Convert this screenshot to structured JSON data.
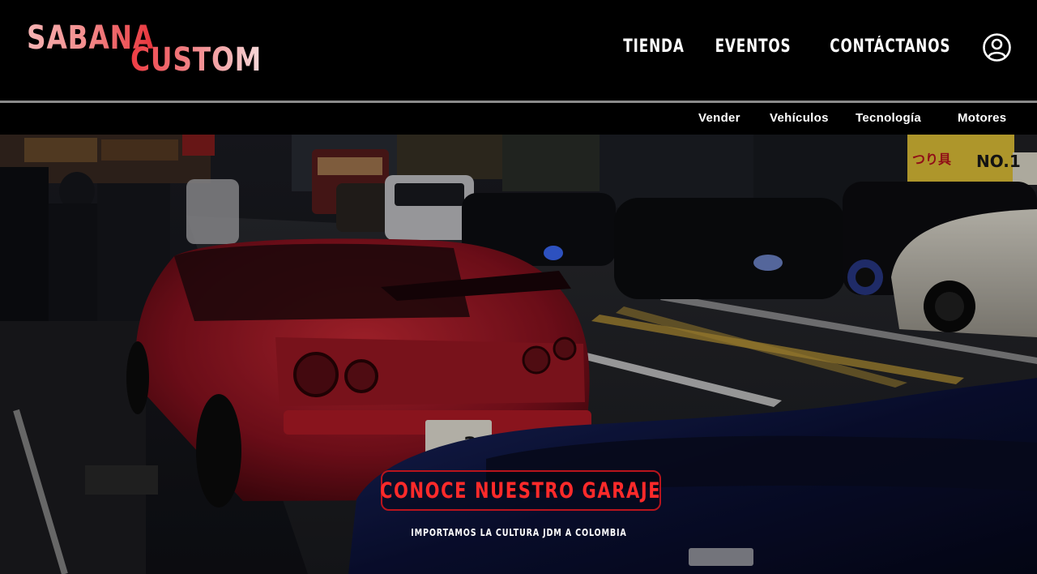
{
  "brand": {
    "line1": "SABANA",
    "line2": "CUSTOM"
  },
  "main_nav": [
    {
      "label": "TIENDA"
    },
    {
      "label": "EVENTOS"
    },
    {
      "label": "CONTÁCTANOS"
    }
  ],
  "icons": {
    "account": "user-circle-icon"
  },
  "sub_nav": [
    {
      "label": "Vender"
    },
    {
      "label": "Vehículos"
    },
    {
      "label": "Tecnología"
    },
    {
      "label": "Motores"
    }
  ],
  "hero": {
    "cta_label": "CONOCE NUESTRO GARAJE",
    "tagline": "IMPORTAMOS LA CULTURA JDM A COLOMBIA",
    "signs": {
      "sign1": "つり具",
      "sign2": "NO.1",
      "plate": "34"
    }
  },
  "colors": {
    "accent": "#e8333a",
    "cta_text": "#ff2a2a",
    "cta_border": "#b9141c",
    "background": "#000000",
    "divider": "#8a8a8a"
  }
}
